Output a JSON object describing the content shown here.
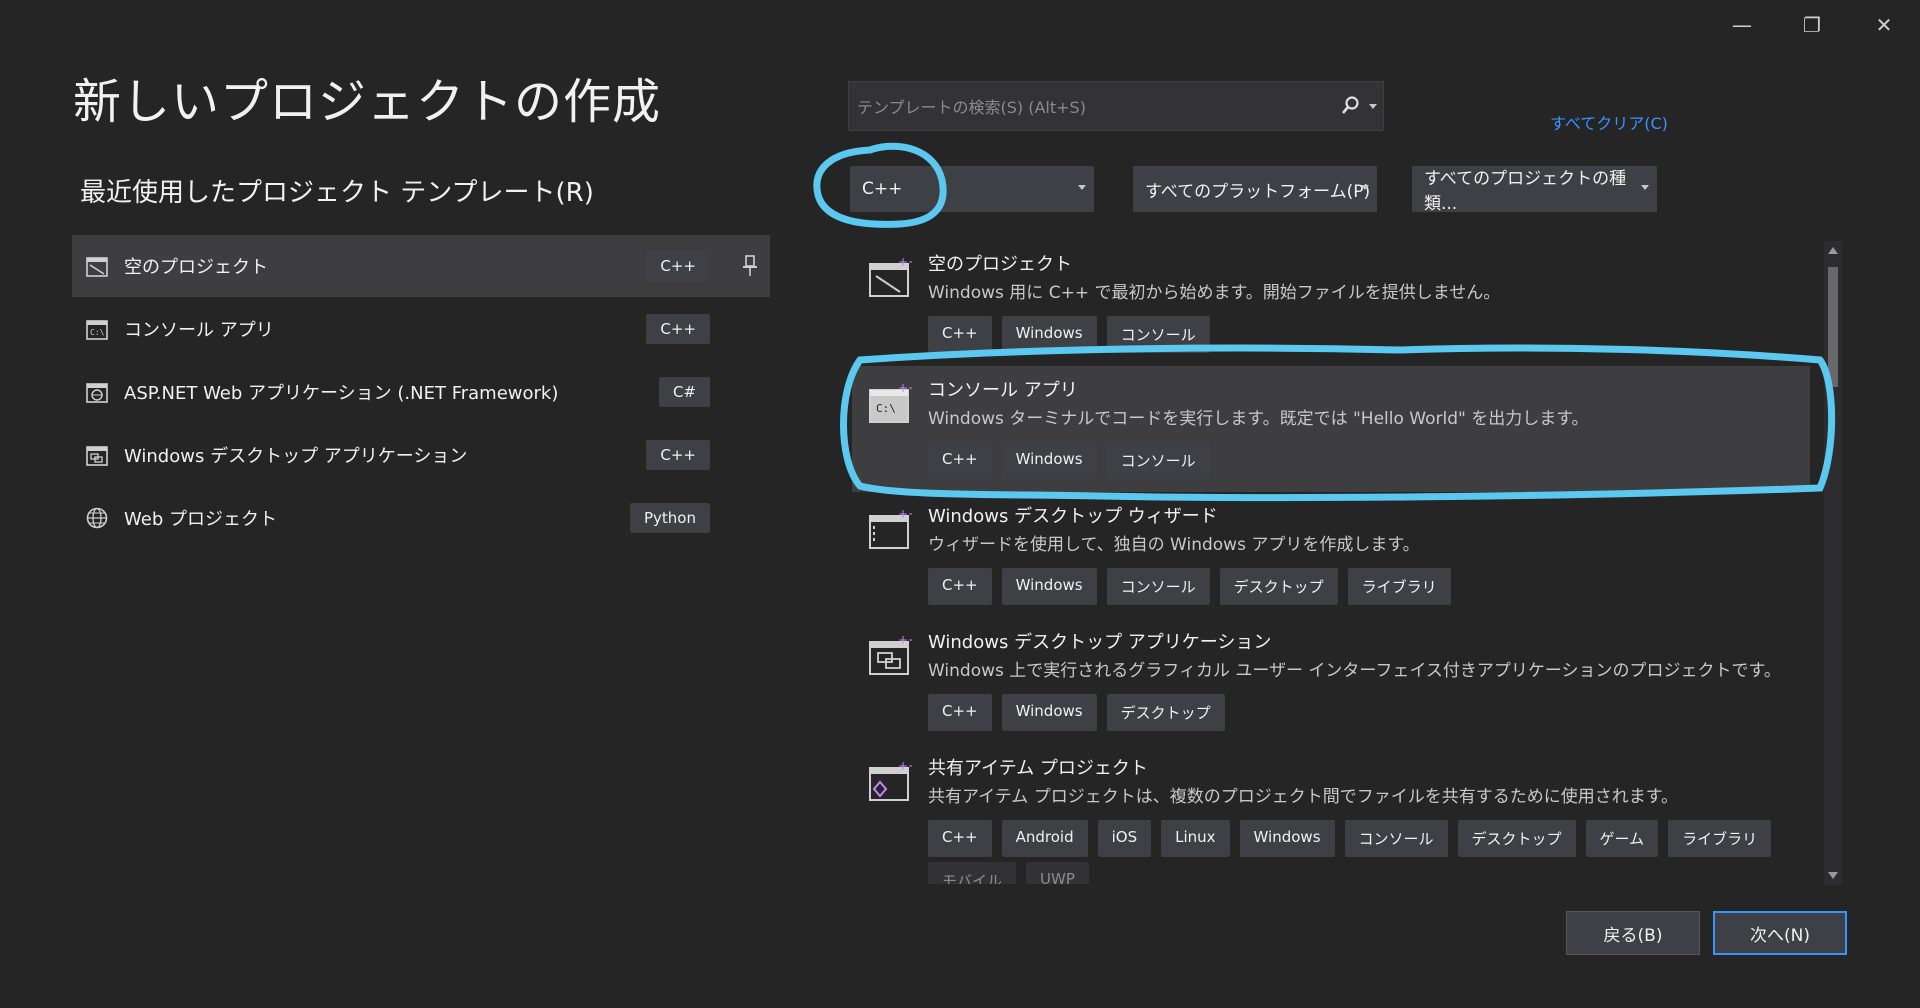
{
  "window": {
    "minimize_glyph": "—",
    "restore_glyph": "❐",
    "close_glyph": "✕"
  },
  "title": "新しいプロジェクトの作成",
  "recent": {
    "heading": "最近使用したプロジェクト テンプレート(R)",
    "items": [
      {
        "label": "空のプロジェクト",
        "lang": "C++",
        "icon": "empty-project-icon"
      },
      {
        "label": "コンソール アプリ",
        "lang": "C++",
        "icon": "console-app-icon"
      },
      {
        "label": "ASP.NET Web アプリケーション (.NET Framework)",
        "lang": "C#",
        "icon": "web-app-icon"
      },
      {
        "label": "Windows デスクトップ アプリケーション",
        "lang": "C++",
        "icon": "desktop-app-icon"
      },
      {
        "label": "Web プロジェクト",
        "lang": "Python",
        "icon": "globe-icon"
      }
    ]
  },
  "search": {
    "placeholder": "テンプレートの検索(S) (Alt+S)"
  },
  "clear_all": "すべてクリア(C)",
  "filters": {
    "language": "C++",
    "platform": "すべてのプラットフォーム(P)",
    "project_type": "すべてのプロジェクトの種類..."
  },
  "templates": [
    {
      "name": "空のプロジェクト",
      "desc": "Windows 用に C++ で最初から始めます。開始ファイルを提供しません。",
      "tags": [
        "C++",
        "Windows",
        "コンソール"
      ],
      "icon": "empty-project-icon"
    },
    {
      "name": "コンソール アプリ",
      "desc": "Windows ターミナルでコードを実行します。既定では \"Hello World\" を出力します。",
      "tags": [
        "C++",
        "Windows",
        "コンソール"
      ],
      "icon": "console-app-icon"
    },
    {
      "name": "Windows デスクトップ ウィザード",
      "desc": "ウィザードを使用して、独自の Windows アプリを作成します。",
      "tags": [
        "C++",
        "Windows",
        "コンソール",
        "デスクトップ",
        "ライブラリ"
      ],
      "icon": "wizard-icon"
    },
    {
      "name": "Windows デスクトップ アプリケーション",
      "desc": "Windows 上で実行されるグラフィカル ユーザー インターフェイス付きアプリケーションのプロジェクトです。",
      "tags": [
        "C++",
        "Windows",
        "デスクトップ"
      ],
      "icon": "desktop-app-icon"
    },
    {
      "name": "共有アイテム プロジェクト",
      "desc": "共有アイテム プロジェクトは、複数のプロジェクト間でファイルを共有するために使用されます。",
      "tags": [
        "C++",
        "Android",
        "iOS",
        "Linux",
        "Windows",
        "コンソール",
        "デスクトップ",
        "ゲーム",
        "ライブラリ"
      ],
      "icon": "shared-items-icon"
    }
  ],
  "partial_tags": [
    "モバイル",
    "UWP"
  ],
  "buttons": {
    "back": "戻る(B)",
    "next": "次へ(N)"
  },
  "colors": {
    "background": "#252526",
    "selected": "#3e3e40",
    "chip": "#3f3f46",
    "accent": "#3794ff",
    "annotation": "#5bc8f0"
  }
}
